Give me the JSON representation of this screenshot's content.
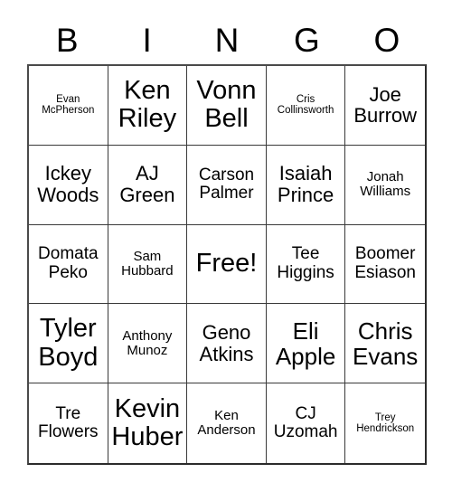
{
  "card": {
    "type": "bingo-card",
    "columns": 5,
    "rows": 5,
    "header": {
      "letters": [
        "B",
        "I",
        "N",
        "G",
        "O"
      ]
    },
    "free_space": {
      "label": "Free!",
      "row": 3,
      "column": 3
    },
    "cells": [
      {
        "text": "Evan\nMcPherson",
        "size": "fs-xs"
      },
      {
        "text": "Ken\nRiley",
        "size": "fs-xxl"
      },
      {
        "text": "Vonn\nBell",
        "size": "fs-xxl"
      },
      {
        "text": "Cris\nCollinsworth",
        "size": "fs-xs"
      },
      {
        "text": "Joe\nBurrow",
        "size": "fs-lg"
      },
      {
        "text": "Ickey\nWoods",
        "size": "fs-lg"
      },
      {
        "text": "AJ\nGreen",
        "size": "fs-lg"
      },
      {
        "text": "Carson\nPalmer",
        "size": "fs-md"
      },
      {
        "text": "Isaiah\nPrince",
        "size": "fs-lg"
      },
      {
        "text": "Jonah\nWilliams",
        "size": "fs-sm"
      },
      {
        "text": "Domata\nPeko",
        "size": "fs-md"
      },
      {
        "text": "Sam\nHubbard",
        "size": "fs-sm"
      },
      {
        "text": "Free!",
        "size": "fs-xxl"
      },
      {
        "text": "Tee\nHiggins",
        "size": "fs-md"
      },
      {
        "text": "Boomer\nEsiason",
        "size": "fs-md"
      },
      {
        "text": "Tyler\nBoyd",
        "size": "fs-xxl"
      },
      {
        "text": "Anthony\nMunoz",
        "size": "fs-sm"
      },
      {
        "text": "Geno\nAtkins",
        "size": "fs-lg"
      },
      {
        "text": "Eli\nApple",
        "size": "fs-xl"
      },
      {
        "text": "Chris\nEvans",
        "size": "fs-xl"
      },
      {
        "text": "Tre\nFlowers",
        "size": "fs-md"
      },
      {
        "text": "Kevin\nHuber",
        "size": "fs-xxl"
      },
      {
        "text": "Ken\nAnderson",
        "size": "fs-sm"
      },
      {
        "text": "CJ\nUzomah",
        "size": "fs-md"
      },
      {
        "text": "Trey\nHendrickson",
        "size": "fs-xs"
      }
    ]
  }
}
